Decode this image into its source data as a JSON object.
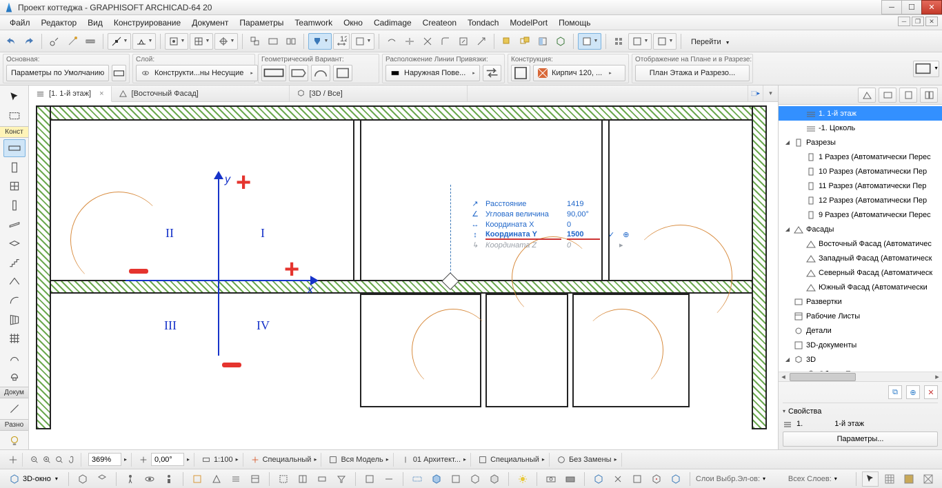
{
  "title": "Проект коттеджа - GRAPHISOFT ARCHICAD-64 20",
  "menu": [
    "Файл",
    "Редактор",
    "Вид",
    "Конструирование",
    "Документ",
    "Параметры",
    "Teamwork",
    "Окно",
    "Cadimage",
    "Createon",
    "Tondach",
    "ModelPort",
    "Помощь"
  ],
  "goto": "Перейти",
  "info": {
    "basic_label": "Основная:",
    "basic_default": "Параметры по Умолчанию",
    "layer_label": "Слой:",
    "layer_value": "Конструкти...ны Несущие",
    "geom_label": "Геометрический Вариант:",
    "refline_label": "Расположение Линии Привязки:",
    "refline_value": "Наружная Пове...",
    "constr_label": "Конструкция:",
    "constr_value": "Кирпич 120, ...",
    "display_label": "Отображение на Плане и в Разрезе:",
    "display_value": "План Этажа и Разрезо..."
  },
  "toolbox": {
    "cat_konst": "Конст",
    "cat_dokum": "Докум",
    "cat_razno": "Разно"
  },
  "tabs": {
    "t1": "[1. 1-й этаж]",
    "t2": "[Восточный Фасад]",
    "t3": "[3D / Все]"
  },
  "axes": {
    "y": "y",
    "x": "x",
    "q1": "I",
    "q2": "II",
    "q3": "III",
    "q4": "IV"
  },
  "tracker": {
    "r1k": "Расстояние",
    "r1v": "1419",
    "r2k": "Угловая величина",
    "r2v": "90,00°",
    "r3k": "Координата X",
    "r3v": "0",
    "r4k": "Координата Y",
    "r4v": "1500",
    "r5k": "Координата Z",
    "r5v": "0"
  },
  "nav": {
    "items": [
      {
        "lvl": 1,
        "t": "1. 1-й этаж",
        "sel": true,
        "icon": "story"
      },
      {
        "lvl": 1,
        "t": "-1. Цоколь",
        "icon": "story"
      },
      {
        "lvl": 0,
        "t": "Разрезы",
        "chev": "▢",
        "icon": "section-group"
      },
      {
        "lvl": 1,
        "t": "1 Разрез (Автоматически Перес",
        "icon": "section"
      },
      {
        "lvl": 1,
        "t": "10 Разрез (Автоматически Пер",
        "icon": "section"
      },
      {
        "lvl": 1,
        "t": "11 Разрез (Автоматически Пер",
        "icon": "section"
      },
      {
        "lvl": 1,
        "t": "12 Разрез (Автоматически Пер",
        "icon": "section"
      },
      {
        "lvl": 1,
        "t": "9 Разрез (Автоматически Перес",
        "icon": "section"
      },
      {
        "lvl": 0,
        "t": "Фасады",
        "chev": "▢",
        "icon": "elevation-group"
      },
      {
        "lvl": 1,
        "t": "Восточный Фасад (Автоматичес",
        "icon": "elevation"
      },
      {
        "lvl": 1,
        "t": "Западный Фасад (Автоматическ",
        "icon": "elevation"
      },
      {
        "lvl": 1,
        "t": "Северный Фасад (Автоматическ",
        "icon": "elevation"
      },
      {
        "lvl": 1,
        "t": "Южный Фасад (Автоматически",
        "icon": "elevation"
      },
      {
        "lvl": 0,
        "t": "Развертки",
        "icon": "interior"
      },
      {
        "lvl": 0,
        "t": "Рабочие Листы",
        "icon": "worksheet"
      },
      {
        "lvl": 0,
        "t": "Детали",
        "icon": "detail"
      },
      {
        "lvl": 0,
        "t": "3D-документы",
        "icon": "3ddoc"
      },
      {
        "lvl": 0,
        "t": "3D",
        "chev": "▢",
        "icon": "3d"
      },
      {
        "lvl": 1,
        "t": "Общая Перспектива",
        "icon": "3dview"
      }
    ],
    "props_label": "Свойства",
    "row_num": "1.",
    "row_name": "1-й этаж",
    "params_btn": "Параметры..."
  },
  "status1": {
    "zoom": "369%",
    "rot": "0,00°",
    "scale": "1:100",
    "s1": "Специальный",
    "s2": "Вся Модель",
    "s3": "01 Архитект...",
    "s4": "Специальный",
    "s5": "Без Замены"
  },
  "status2": {
    "btn3d": "3D-окно",
    "layers_lbl": "Слои Выбр.Эл-ов:",
    "alllayers": "Всех Слоев:"
  }
}
